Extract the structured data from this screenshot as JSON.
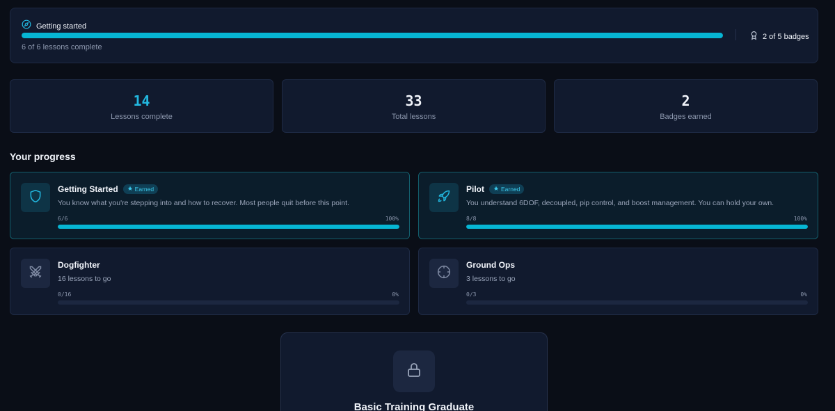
{
  "banner": {
    "title": "Getting started",
    "progress": 1.0,
    "subtitle": "6 of 6 lessons complete",
    "badges_text": "2 of 5 badges"
  },
  "stats": [
    {
      "value": "14",
      "label": "Lessons complete",
      "accent": true
    },
    {
      "value": "33",
      "label": "Total lessons",
      "accent": false
    },
    {
      "value": "2",
      "label": "Badges earned",
      "accent": false
    }
  ],
  "section_title": "Your progress",
  "cards": [
    {
      "name": "Getting Started",
      "earned": true,
      "pill": "Earned",
      "desc": "You know what you're stepping into and how to recover. Most people quit before this point.",
      "count": "6/6",
      "pct": "100%",
      "progress": 1.0,
      "icon": "shield-icon"
    },
    {
      "name": "Pilot",
      "earned": true,
      "pill": "Earned",
      "desc": "You understand 6DOF, decoupled, pip control, and boost management. You can hold your own.",
      "count": "8/8",
      "pct": "100%",
      "progress": 1.0,
      "icon": "rocket-icon"
    },
    {
      "name": "Dogfighter",
      "earned": false,
      "desc": "16 lessons to go",
      "count": "0/16",
      "pct": "0%",
      "progress": 0,
      "icon": "crossed-swords-icon"
    },
    {
      "name": "Ground Ops",
      "earned": false,
      "desc": "3 lessons to go",
      "count": "0/3",
      "pct": "0%",
      "progress": 0,
      "icon": "crosshair-icon"
    }
  ],
  "locked_badge": {
    "title": "Basic Training Graduate",
    "icon": "lock-icon"
  },
  "colors": {
    "accent": "#06b6d4",
    "background": "#0a0e17",
    "card": "#111a2e"
  }
}
